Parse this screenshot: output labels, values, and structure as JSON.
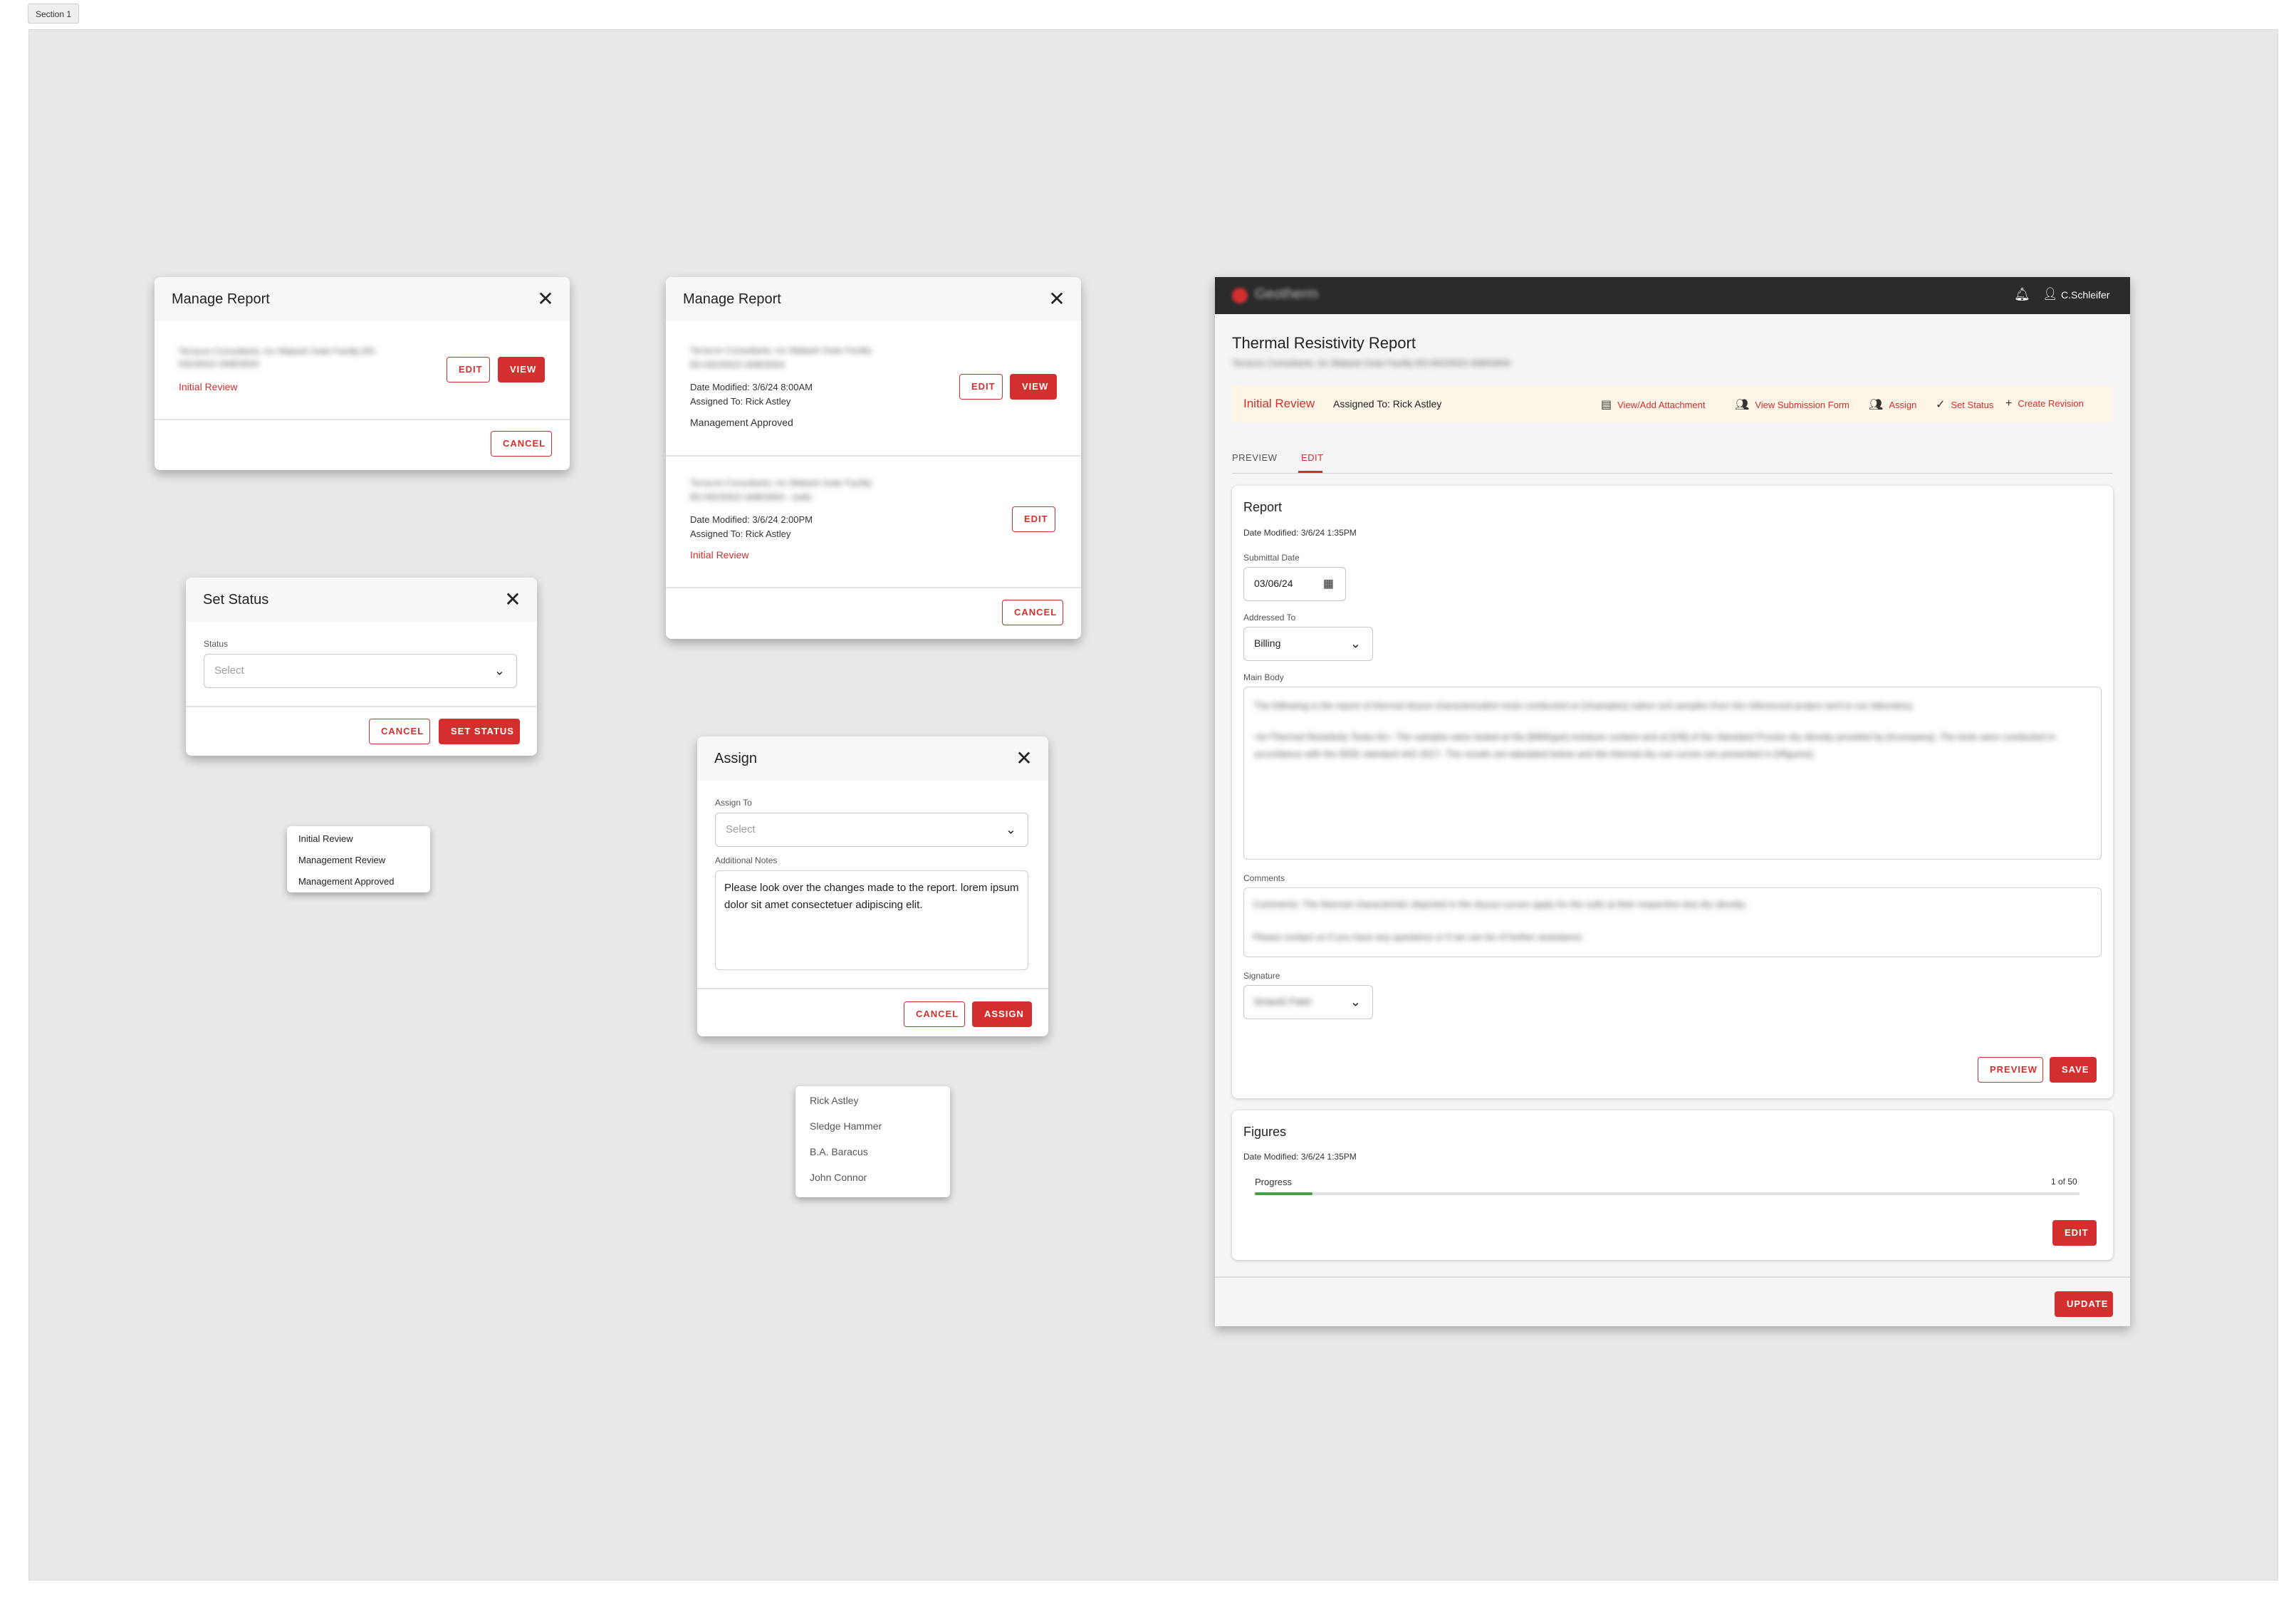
{
  "section_tag": "Section 1",
  "manage_report_1": {
    "title": "Manage Report",
    "item": {
      "blurred_line": "Terracon Consultants, Inc Wabash Solar Facility BS-NSO0022-3AB03004",
      "status": "Initial Review",
      "edit": "EDIT",
      "view": "VIEW"
    },
    "cancel": "CANCEL"
  },
  "manage_report_2": {
    "title": "Manage Report",
    "items": [
      {
        "blurred_line1": "Terracon Consultants, Inc Wabash Solar Facility",
        "blurred_line2": "BS-NSO0022-3AB03004",
        "date": "Date Modified: 3/6/24 8:00AM",
        "assigned": "Assigned To: Rick Astley",
        "status": "Management Approved",
        "edit": "EDIT",
        "view": "VIEW"
      },
      {
        "blurred_line1": "Terracon Consultants, Inc Wabash Solar Facility",
        "blurred_line2": "BS-NSO0022-3AB03004 - (edit)",
        "date": "Date Modified: 3/6/24 2:00PM",
        "assigned": "Assigned To: Rick Astley",
        "status": "Initial Review",
        "edit": "EDIT"
      }
    ],
    "cancel": "CANCEL"
  },
  "set_status": {
    "title": "Set Status",
    "status_label": "Status",
    "status_placeholder": "Select",
    "cancel": "CANCEL",
    "submit": "SET STATUS",
    "options": [
      "Initial Review",
      "Management Review",
      "Management Approved"
    ]
  },
  "assign": {
    "title": "Assign",
    "assign_to_label": "Assign To",
    "assign_to_placeholder": "Select",
    "notes_label": "Additional Notes",
    "notes_value": "Please look over the changes made to the report. lorem ipsum dolor sit amet consectetuer adipiscing elit.",
    "cancel": "CANCEL",
    "submit": "ASSIGN",
    "options": [
      "Rick Astley",
      "Sledge Hammer",
      "B.A. Baracus",
      "John Connor"
    ]
  },
  "app": {
    "brand": "Geotherm",
    "user": "C.Schleifer",
    "page_title": "Thermal Resistivity Report",
    "page_subtitle": "Terracon Consultants, Inc Wabash Solar Facility BS-NSO0022-3AB03004",
    "status": "Initial Review",
    "assigned": "Assigned To: Rick Astley",
    "actions": [
      "View/Add Attachment",
      "View Submission Form",
      "Assign",
      "Set Status",
      "Create Revision"
    ],
    "tabs": [
      "PREVIEW",
      "EDIT"
    ],
    "active_tab": "EDIT",
    "report": {
      "heading": "Report",
      "date_modified": "Date Modified: 3/6/24 1:35PM",
      "submittal_label": "Submittal Date",
      "submittal_value": "03/06/24",
      "addressed_label": "Addressed To",
      "addressed_value": "Billing",
      "main_body_label": "Main Body",
      "main_body_p1": "The following is the report of thermal dryout characterization tests conducted on [#samples] native soil samples from the referenced project sent to our laboratory.",
      "main_body_p2": "<b>Thermal Resistivity Tests</b>: The samples were tested at the [MM/type] moisture content and at [#/ft] of the Standard Proctor dry density provided by [#company]. The tests were conducted in accordance with the IEEE standard 442-2017. The results are tabulated below and the thermal dry out curves are presented in [#figures].",
      "comments_label": "Comments",
      "comments_p1": "Comments: The thermal characteristic depicted in the dryout curves apply for the soils at their respective test dry density.",
      "comments_p2": "Please contact us if you have any questions or if we can be of further assistance.",
      "signature_label": "Signature",
      "signature_value": "Nnaedi Patel",
      "preview_btn": "PREVIEW",
      "save_btn": "SAVE"
    },
    "figures": {
      "heading": "Figures",
      "date_modified": "Date Modified: 3/6/24 1:35PM",
      "progress_label": "Progress",
      "progress_count": "1 of 50",
      "progress_fraction": 0.02,
      "edit_btn": "EDIT"
    },
    "update_btn": "UPDATE",
    "colors": {
      "accent": "#d32f2f",
      "appbar": "#2b2b2b",
      "status_bar": "#fdf6e6",
      "progress": "#43a047"
    }
  }
}
